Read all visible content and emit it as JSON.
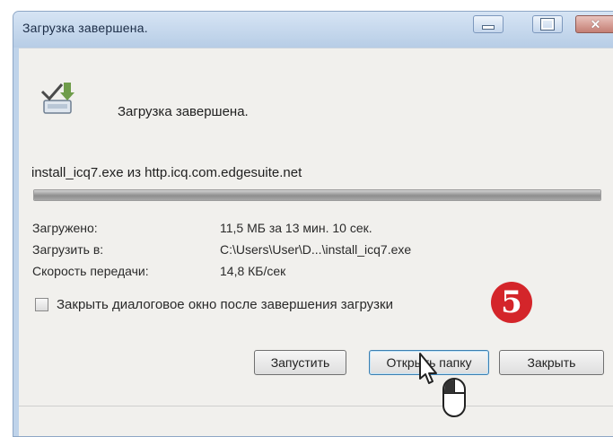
{
  "window": {
    "title": "Загрузка завершена."
  },
  "dialog": {
    "heading": "Загрузка завершена.",
    "source": "install_icq7.exe из http.icq.com.edgesuite.net",
    "progress_percent": 100,
    "details": [
      {
        "label": "Загружено:",
        "value": "11,5 МБ за 13 мин. 10 сек."
      },
      {
        "label": "Загрузить в:",
        "value": "C:\\Users\\User\\D...\\install_icq7.exe"
      },
      {
        "label": "Скорость передачи:",
        "value": "14,8 КБ/сек"
      }
    ],
    "close_on_finish_label": "Закрыть диалоговое окно после завершения загрузки",
    "close_on_finish_checked": false,
    "buttons": {
      "run": "Запустить",
      "open_folder": "Открыть папку",
      "close": "Закрыть"
    }
  },
  "annotation": {
    "step": "5"
  },
  "icons": {
    "download": "download-complete-icon",
    "cursor": "mouse-cursor-icon"
  },
  "colors": {
    "badge": "#d4252a",
    "title_bar": "#bfd3ea"
  }
}
